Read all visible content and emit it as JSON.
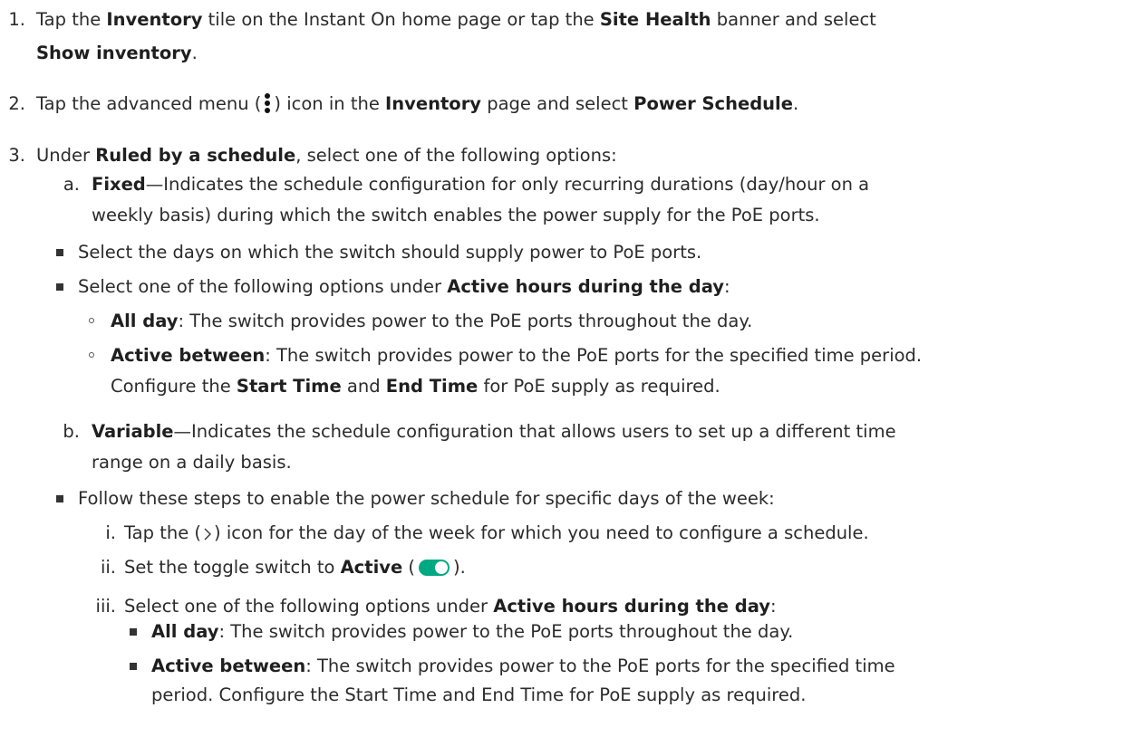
{
  "steps": {
    "s1": {
      "num": "1.",
      "t1": "Tap the ",
      "b1": "Inventory",
      "t2": " tile on the Instant On home page or tap the ",
      "b2": "Site Health",
      "t3": " banner and select",
      "b3": "Show inventory",
      "t4": "."
    },
    "s2": {
      "num": "2.",
      "t1": "Tap the advanced menu (",
      "t2": ") icon in the ",
      "b1": "Inventory",
      "t3": " page and select ",
      "b2": "Power Schedule",
      "t4": "."
    },
    "s3": {
      "num": "3.",
      "t1": "Under ",
      "b1": "Ruled by a schedule",
      "t2": ", select one of the following options:"
    },
    "a": {
      "num": "a.",
      "b1": "Fixed",
      "t1": "—Indicates the schedule configuration for only recurring durations (day/hour on a",
      "t2": "weekly basis) during which the switch enables the power supply for the PoE ports."
    },
    "a_bullet1": "Select the days on which the switch should supply power to PoE ports.",
    "a_bullet2": {
      "t1": "Select one of the following options under ",
      "b1": "Active hours during the day",
      "t2": ":"
    },
    "a_sub1": {
      "b1": "All day",
      "t1": ": The switch provides power to the PoE ports throughout the day."
    },
    "a_sub2": {
      "b1": "Active between",
      "t1": ": The switch provides power to the PoE ports for the specified time period.",
      "t2": "Configure the ",
      "b2": "Start Time",
      "t3": " and ",
      "b3": "End Time",
      "t4": " for PoE supply as required."
    },
    "b": {
      "num": "b.",
      "b1": "Variable",
      "t1": "—Indicates the schedule configuration that allows users to set up a different time",
      "t2": "range on a daily basis."
    },
    "b_bullet1": "Follow these steps to enable the power schedule for specific days of the week:",
    "i": {
      "num": "i.",
      "t1": "Tap the (",
      "t2": ") icon for the day of the week for which you need to configure a schedule."
    },
    "ii": {
      "num": "ii.",
      "t1": "Set the toggle switch to ",
      "b1": "Active",
      "t2": " (",
      "t3": ")."
    },
    "iii": {
      "num": "iii.",
      "t1": "Select one of the following options under ",
      "b1": "Active hours during the day",
      "t2": ":"
    },
    "iii_sub1": {
      "b1": "All day",
      "t1": ": The switch provides power to the PoE ports throughout the day."
    },
    "iii_sub2": {
      "b1": "Active between",
      "t1": ": The switch provides power to the PoE ports for the specified time",
      "t2": "period. Configure the Start Time and End Time for PoE supply as required."
    }
  },
  "colors": {
    "toggle_green": "#01a982",
    "text": "#2b2b2b"
  }
}
